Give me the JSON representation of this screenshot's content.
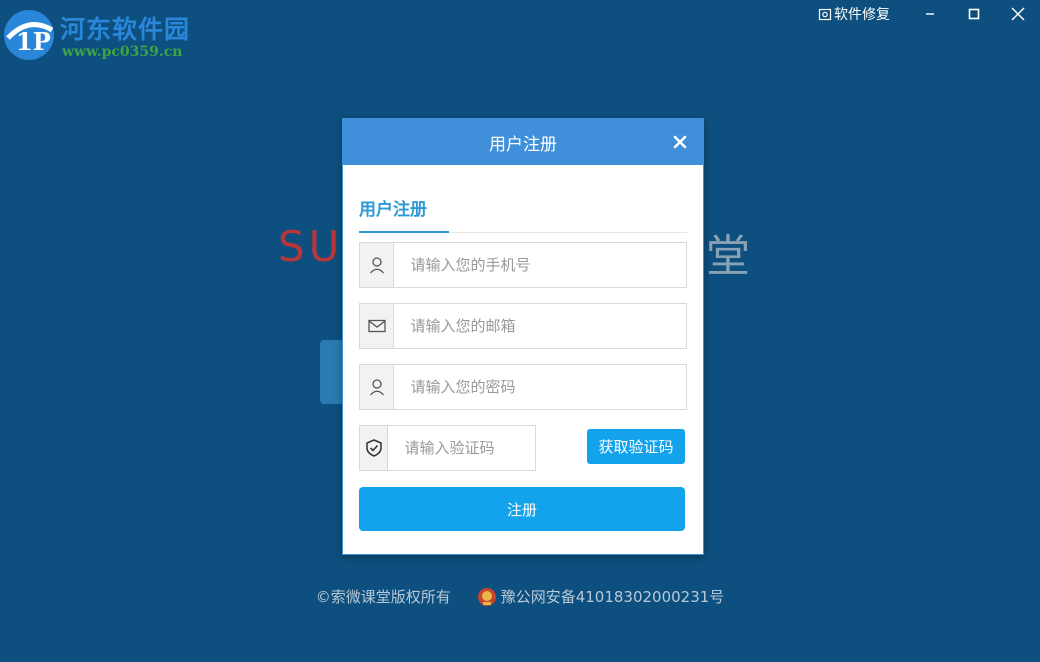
{
  "watermark": {
    "title": "河东软件园",
    "url": "www.pc0359.cn"
  },
  "titlebar": {
    "repair_label": "软件修复",
    "minimize_icon": "minimize-icon",
    "maximize_icon": "maximize-icon",
    "close_icon": "close-icon"
  },
  "background": {
    "brand_left": "SU",
    "brand_right": "堂"
  },
  "dialog": {
    "title": "用户注册",
    "tab_label": "用户注册",
    "phone_placeholder": "请输入您的手机号",
    "email_placeholder": "请输入您的邮箱",
    "password_placeholder": "请输入您的密码",
    "code_placeholder": "请输入验证码",
    "get_code_label": "获取验证码",
    "submit_label": "注册"
  },
  "footer": {
    "copyright": "©索微课堂版权所有",
    "record": "豫公网安备41018302000231号"
  },
  "colors": {
    "background": "#0d4f7e",
    "header": "#3f8fda",
    "accent": "#13a3ec"
  }
}
